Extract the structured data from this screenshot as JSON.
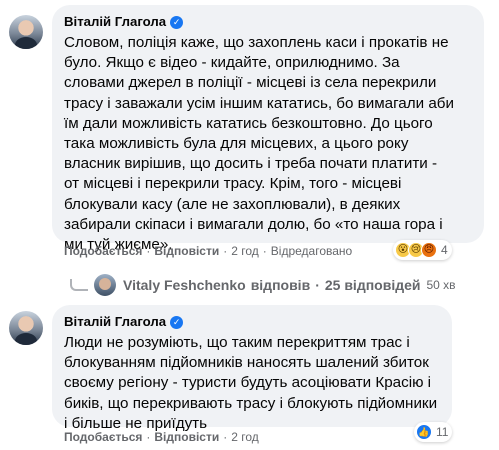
{
  "comments": [
    {
      "author": "Віталій Глагола",
      "text": "Словом, поліція каже, що захоплень каси і прокатів не\nбуло. Якщо є відео - кидайте, оприлюднимо. За\nсловами джерел в поліції - місцеві із села перекрили\nтрасу і заважали усім іншим кататись, бо вимагали аби\nїм дали можливість кататись безкоштовно. До цього\nтака можливість була для місцевих, а цього року\nвласник вирішив, що досить і треба почати платити -\nот місцеві і перекрили трасу. Крім, того - місцеві\nблокували касу (але не захоплювали), в деяких\nзабирали скіпаси і вимагали долю, бо «то наша гора і\nми туй жиєме».",
      "actions": {
        "like": "Подобається",
        "reply": "Відповісти",
        "time": "2 год",
        "edited": "Відредаговано"
      },
      "reactions": {
        "icons": [
          "wow-icon",
          "sad-icon",
          "angry-icon"
        ],
        "count": "4"
      },
      "replies": {
        "replier": "Vitaly Feshchenko",
        "verb": "відповів",
        "count_text": "25 відповідей",
        "time": "50 хв"
      }
    },
    {
      "author": "Віталій Глагола",
      "text": "Люди не розуміють, що таким перекриттям трас і\nблокуванням підйомників наносять шалений збиток\nсвоєму регіону - туристи будуть асоціювати Красію і\nбиків, що перекривають трасу і блокують підйомники\nі більше не приїдуть",
      "actions": {
        "like": "Подобається",
        "reply": "Відповісти",
        "time": "2 год"
      },
      "reactions": {
        "icons": [
          "like-icon"
        ],
        "count": "11"
      }
    }
  ],
  "colors": {
    "bubble": "#f0f2f5",
    "meta": "#65676b",
    "accent": "#1877f2"
  }
}
